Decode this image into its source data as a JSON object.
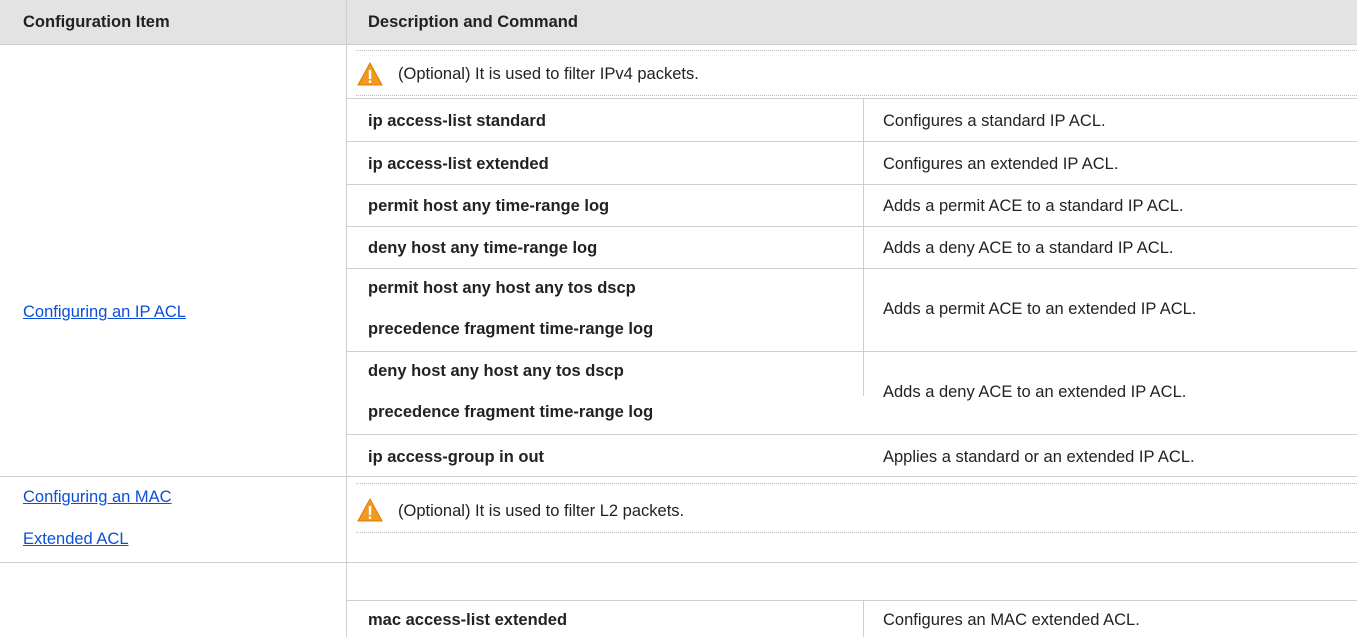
{
  "header": {
    "col1": "Configuration Item",
    "col2": "Description and Command"
  },
  "sections": [
    {
      "item_lines": [
        "Configuring an IP ACL"
      ],
      "note": "(Optional) It is used to filter IPv4 packets.",
      "note_icon": "warning-icon",
      "rows": [
        {
          "command": [
            "ip access-list standard"
          ],
          "description": "Configures a standard IP ACL."
        },
        {
          "command": [
            "ip access-list extended"
          ],
          "description": "Configures an extended IP ACL."
        },
        {
          "command": [
            "permit host any time-range log"
          ],
          "description": "Adds a permit ACE to a standard IP ACL."
        },
        {
          "command": [
            "deny host any time-range log"
          ],
          "description": "Adds a deny ACE to a standard IP ACL."
        },
        {
          "command": [
            "permit host any host any tos dscp",
            "precedence fragment time-range log"
          ],
          "description": "Adds a permit ACE to an extended IP ACL."
        },
        {
          "command": [
            "deny host any host any tos dscp",
            "precedence fragment time-range log"
          ],
          "description": "Adds a deny ACE to an extended IP ACL."
        },
        {
          "command": [
            "ip access-group in out"
          ],
          "description": "Applies a standard or an extended IP ACL."
        }
      ]
    },
    {
      "item_lines": [
        "Configuring an MAC",
        "Extended ACL"
      ],
      "note": "(Optional) It is used to filter L2 packets.",
      "note_icon": "warning-icon",
      "rows": [
        {
          "command": [
            "mac access-list extended"
          ],
          "description": "Configures an MAC extended ACL."
        }
      ]
    }
  ],
  "colors": {
    "header_bg": "#e3e3e3",
    "link": "#0b4fd8",
    "grid": "#cfcfcf",
    "warning": "#f39a1e"
  }
}
